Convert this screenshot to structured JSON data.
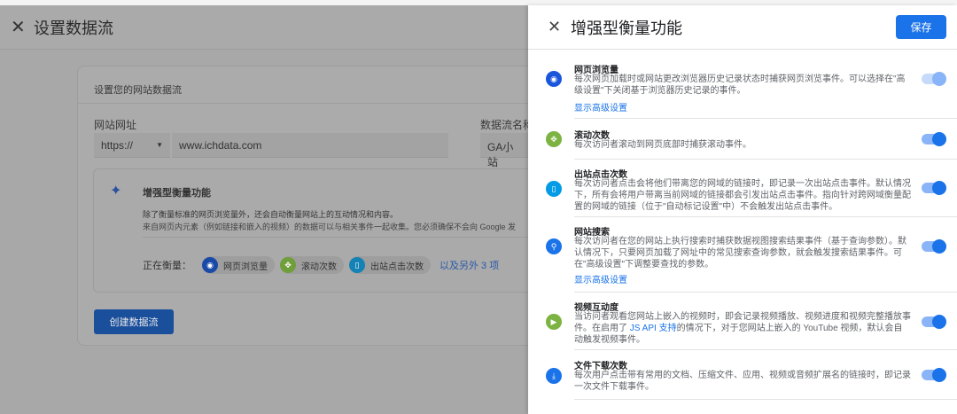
{
  "left": {
    "title": "设置数据流",
    "card_title": "设置您的网站数据流",
    "url_label": "网站网址",
    "protocol": "https://",
    "url_value": "www.ichdata.com",
    "stream_name_label": "数据流名称",
    "stream_name_value": "GA小站",
    "enhanced": {
      "title": "增强型衡量功能",
      "desc1": "除了衡量标准的网页浏览量外，还会自动衡量网站上的互动情况和内容。",
      "desc2": "来自网页内元素（例如链接和嵌入的视频）的数据可以与相关事件一起收集。您必须确保不会向 Google 发",
      "measuring_label": "正在衡量：",
      "chips": [
        "网页浏览量",
        "滚动次数",
        "出站点击次数"
      ],
      "more": "以及另外 3 项"
    },
    "create_button": "创建数据流"
  },
  "panel": {
    "title": "增强型衡量功能",
    "save": "保存",
    "advanced_link": "显示高级设置",
    "items": [
      {
        "title": "网页浏览量",
        "desc": "每次网页加载时或网站更改浏览器历史记录状态时捕获网页浏览事件。可以选择在\"高级设置\"下关闭基于浏览器历史记录的事件。",
        "enabled": true,
        "color": "#1a56db"
      },
      {
        "title": "滚动次数",
        "desc": "每次访问者滚动到网页底部时捕获滚动事件。",
        "enabled": true,
        "color": "#7cb342"
      },
      {
        "title": "出站点击次数",
        "desc": "每次访问者点击会将他们带离您的网域的链接时，即记录一次出站点击事件。默认情况下，所有会将用户带离当前网域的链接都会引发出站点击事件。指向针对跨网域衡量配置的网域的链接（位于\"自动标记设置\"中）不会触发出站点击事件。",
        "enabled": true,
        "color": "#039be5"
      },
      {
        "title": "网站搜索",
        "desc": "每次访问者在您的网站上执行搜索时捕获数据视图搜索结果事件（基于查询参数）。默认情况下，只要网页加载了网址中的常见搜索查询参数，就会触发搜索结果事件。可在\"高级设置\"下调整要查找的参数。",
        "enabled": true,
        "color": "#1a73e8"
      },
      {
        "title": "视频互动度",
        "desc_a": "当访问者观看您网站上嵌入的视频时，即会记录视频播放、视频进度和视频完整播放事件。在启用了 ",
        "desc_link": "JS API 支持",
        "desc_b": "的情况下，对于您网站上嵌入的 YouTube 视频，默认会自动触发视频事件。",
        "enabled": true,
        "color": "#7cb342"
      },
      {
        "title": "文件下载次数",
        "desc": "每次用户点击带有常用的文档、压缩文件、应用、视频或音频扩展名的链接时，即记录一次文件下载事件。",
        "enabled": true,
        "color": "#1a73e8"
      }
    ]
  }
}
